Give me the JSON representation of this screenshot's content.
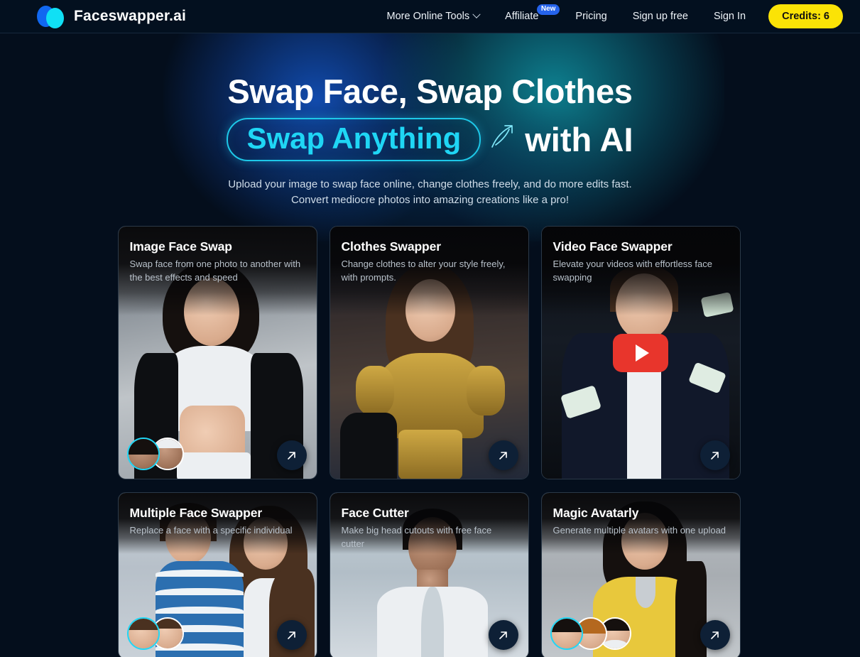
{
  "header": {
    "brand_name": "Faceswapper.ai",
    "nav": [
      {
        "label": "More Online Tools",
        "icon": "chevron-down-icon",
        "has_chevron": true,
        "badge": ""
      },
      {
        "label": "Affiliate",
        "icon": "",
        "has_chevron": false,
        "badge": "New"
      },
      {
        "label": "Pricing",
        "icon": "",
        "has_chevron": false,
        "badge": ""
      },
      {
        "label": "Sign up free",
        "icon": "",
        "has_chevron": false,
        "badge": ""
      },
      {
        "label": "Sign In",
        "icon": "",
        "has_chevron": false,
        "badge": ""
      }
    ],
    "credits_label": "Credits: 6"
  },
  "hero": {
    "title_line1": "Swap Face, Swap Clothes",
    "pill_label": "Swap Anything",
    "arrow_icon": "doodle-arrow-icon",
    "title_line2_tail": "with AI",
    "subtitle_line1": "Upload your image to swap face online, change clothes freely, and do more edits fast.",
    "subtitle_line2": "Convert mediocre photos into amazing creations like a pro!"
  },
  "cards": [
    {
      "title": "Image Face Swap",
      "desc": "Swap face from one photo to another with the best effects and speed",
      "go_icon": "arrow-up-right-icon",
      "thumb_count": 2,
      "has_play": false
    },
    {
      "title": "Clothes Swapper",
      "desc": "Change clothes to alter your style freely, with prompts.",
      "go_icon": "arrow-up-right-icon",
      "thumb_count": 0,
      "has_play": false
    },
    {
      "title": "Video Face Swapper",
      "desc": "Elevate your videos with effortless face swapping",
      "go_icon": "arrow-up-right-icon",
      "thumb_count": 0,
      "has_play": true,
      "play_icon": "play-button-icon"
    },
    {
      "title": "Multiple Face Swapper",
      "desc": "Replace a face with a specific individual",
      "go_icon": "arrow-up-right-icon",
      "thumb_count": 2,
      "has_play": false
    },
    {
      "title": "Face Cutter",
      "desc": "Make big head cutouts with free face cutter",
      "go_icon": "arrow-up-right-icon",
      "thumb_count": 0,
      "has_play": false
    },
    {
      "title": "Magic Avatarly",
      "desc": "Generate multiple avatars with one upload",
      "go_icon": "arrow-up-right-icon",
      "thumb_count": 3,
      "has_play": false
    }
  ],
  "colors": {
    "page_background": "#040e1c",
    "header_background": "#03101f",
    "accent_cyan": "#1fd6f5",
    "accent_blue": "#1168f0",
    "credits_yellow": "#fbe306",
    "badge_blue": "#2563eb",
    "play_red": "#e8352c"
  }
}
